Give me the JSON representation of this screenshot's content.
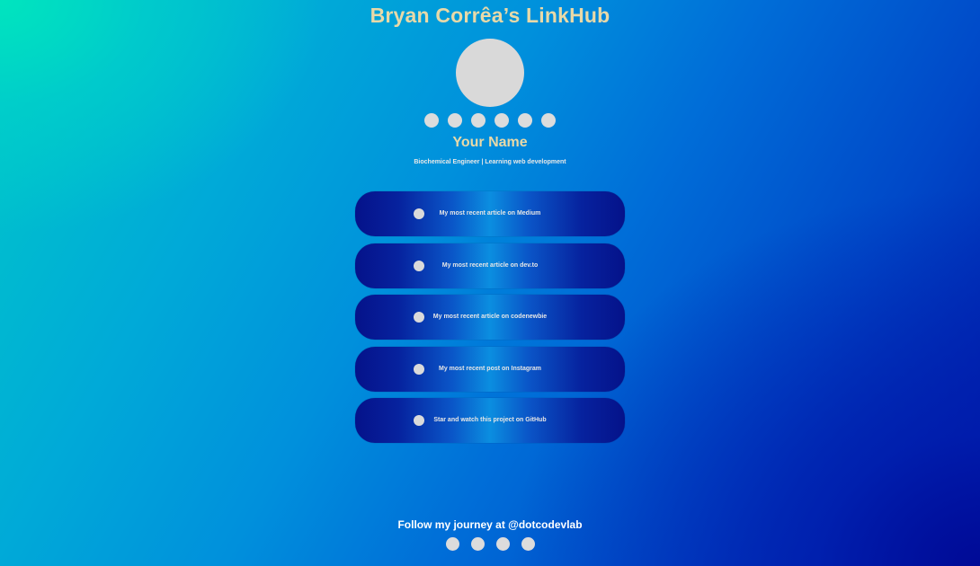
{
  "page": {
    "title": "Bryan Corrêa’s LinkHub"
  },
  "profile": {
    "avatar_icon": "avatar-placeholder",
    "name": "Your Name",
    "bio": "Biochemical Engineer | Learning web development"
  },
  "social_icons": [
    {
      "icon": "social-icon-1"
    },
    {
      "icon": "social-icon-2"
    },
    {
      "icon": "social-icon-3"
    },
    {
      "icon": "social-icon-4"
    },
    {
      "icon": "social-icon-5"
    },
    {
      "icon": "social-icon-6"
    }
  ],
  "links": [
    {
      "icon": "medium-icon",
      "label": "My most recent article on Medium"
    },
    {
      "icon": "devto-icon",
      "label": "My most recent article on dev.to"
    },
    {
      "icon": "codenewbie-icon",
      "label": "My most recent article on codenewbie"
    },
    {
      "icon": "instagram-icon",
      "label": "My most recent post on Instagram"
    },
    {
      "icon": "github-icon",
      "label": "Star and watch this project on GitHub"
    }
  ],
  "footer": {
    "text": "Follow my journey at @dotcodevlab",
    "social_icons": [
      {
        "icon": "footer-social-icon-1"
      },
      {
        "icon": "footer-social-icon-2"
      },
      {
        "icon": "footer-social-icon-3"
      },
      {
        "icon": "footer-social-icon-4"
      }
    ]
  },
  "colors": {
    "title": "#e8d9a8",
    "button_dark": "#05128a",
    "button_light": "#0b8ee0",
    "background_top_left": "#00e6be",
    "background_bottom_right": "#000a96"
  }
}
